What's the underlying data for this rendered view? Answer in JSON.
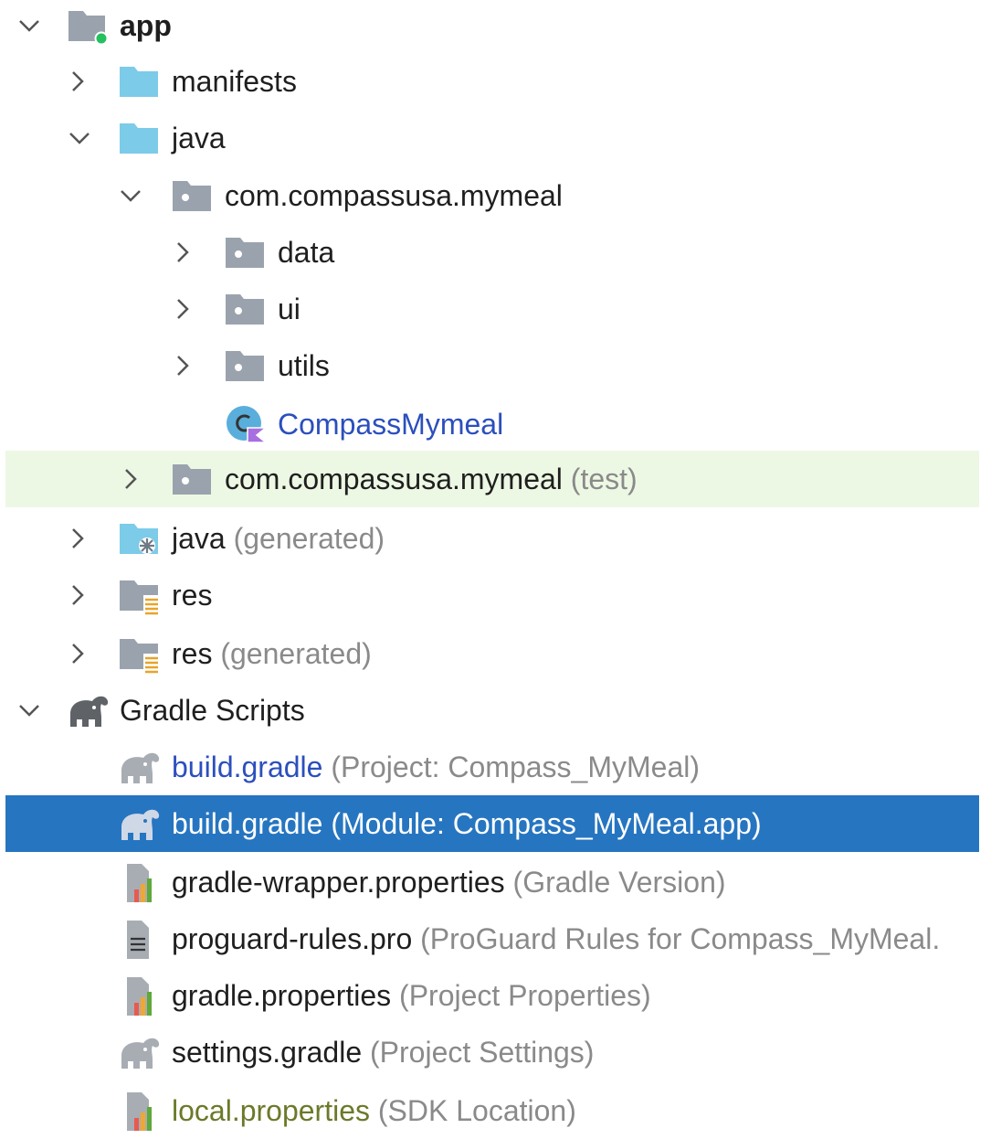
{
  "tree": {
    "app": {
      "label": "app"
    },
    "manifests": {
      "label": "manifests"
    },
    "java": {
      "label": "java"
    },
    "main_package": {
      "label": "com.compassusa.mymeal"
    },
    "data": {
      "label": "data"
    },
    "ui": {
      "label": "ui"
    },
    "utils": {
      "label": "utils"
    },
    "compass_mymeal": {
      "label": "CompassMymeal"
    },
    "test_package": {
      "label": "com.compassusa.mymeal",
      "suffix": "(test)"
    },
    "java_generated": {
      "label": "java",
      "suffix": "(generated)"
    },
    "res": {
      "label": "res"
    },
    "res_generated": {
      "label": "res",
      "suffix": "(generated)"
    },
    "gradle_scripts": {
      "label": "Gradle Scripts"
    },
    "build_gradle_project": {
      "label": "build.gradle",
      "suffix": "(Project: Compass_MyMeal)"
    },
    "build_gradle_module": {
      "label": "build.gradle",
      "suffix": "(Module: Compass_MyMeal.app)"
    },
    "gradle_wrapper_properties": {
      "label": "gradle-wrapper.properties",
      "suffix": "(Gradle Version)"
    },
    "proguard_rules": {
      "label": "proguard-rules.pro",
      "suffix": "(ProGuard Rules for Compass_MyMeal."
    },
    "gradle_properties": {
      "label": "gradle.properties",
      "suffix": "(Project Properties)"
    },
    "settings_gradle": {
      "label": "settings.gradle",
      "suffix": "(Project Settings)"
    },
    "local_properties": {
      "label": "local.properties",
      "suffix": "(SDK Location)"
    }
  },
  "colors": {
    "selection": "#2675c0",
    "test_highlight": "#edf8e4",
    "link_blue": "#2b4fbd",
    "olive": "#6a7a2a",
    "muted": "#8a8a8a",
    "folder_blue": "#7ccbe8"
  },
  "icons": {
    "app": "module-folder-icon",
    "manifests": "folder-icon",
    "java": "source-folder-icon",
    "package": "package-icon",
    "kotlin_class": "kotlin-class-icon",
    "generated": "generated-source-icon",
    "res": "resources-folder-icon",
    "gradle": "gradle-elephant-icon",
    "properties": "properties-file-icon",
    "text_file": "text-file-icon"
  }
}
